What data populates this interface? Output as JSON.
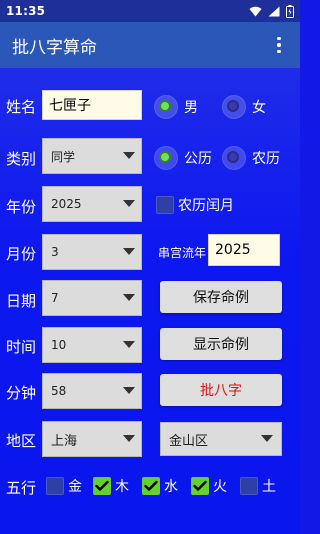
{
  "status_bar": {
    "time": "11:35"
  },
  "app_bar": {
    "title": "批八字算命"
  },
  "form": {
    "name": {
      "label": "姓名",
      "value": "七匣子"
    },
    "gender": {
      "options": [
        {
          "label": "男",
          "checked": true
        },
        {
          "label": "女",
          "checked": false
        }
      ]
    },
    "category": {
      "label": "类别",
      "value": "同学"
    },
    "calendar": {
      "options": [
        {
          "label": "公历",
          "checked": true
        },
        {
          "label": "农历",
          "checked": false
        }
      ]
    },
    "year": {
      "label": "年份",
      "value": "2025"
    },
    "leap_month": {
      "label": "农历闰月",
      "checked": false
    },
    "month": {
      "label": "月份",
      "value": "3"
    },
    "palace_year": {
      "label": "串宫流年",
      "value": "2025"
    },
    "day": {
      "label": "日期",
      "value": "7"
    },
    "hour": {
      "label": "时间",
      "value": "10"
    },
    "minute": {
      "label": "分钟",
      "value": "58"
    },
    "region": {
      "label": "地区",
      "province": "上海",
      "district": "金山区"
    },
    "five_elements": {
      "label": "五行",
      "items": [
        {
          "label": "金",
          "checked": false
        },
        {
          "label": "木",
          "checked": true
        },
        {
          "label": "水",
          "checked": true
        },
        {
          "label": "火",
          "checked": true
        },
        {
          "label": "土",
          "checked": false
        }
      ]
    }
  },
  "buttons": {
    "save": "保存命例",
    "show": "显示命例",
    "compute": "批八字"
  },
  "colors": {
    "background": "#1219e6",
    "app_bar": "#2a57b8",
    "accent_check": "#63d12f",
    "compute_text": "#e01010"
  }
}
